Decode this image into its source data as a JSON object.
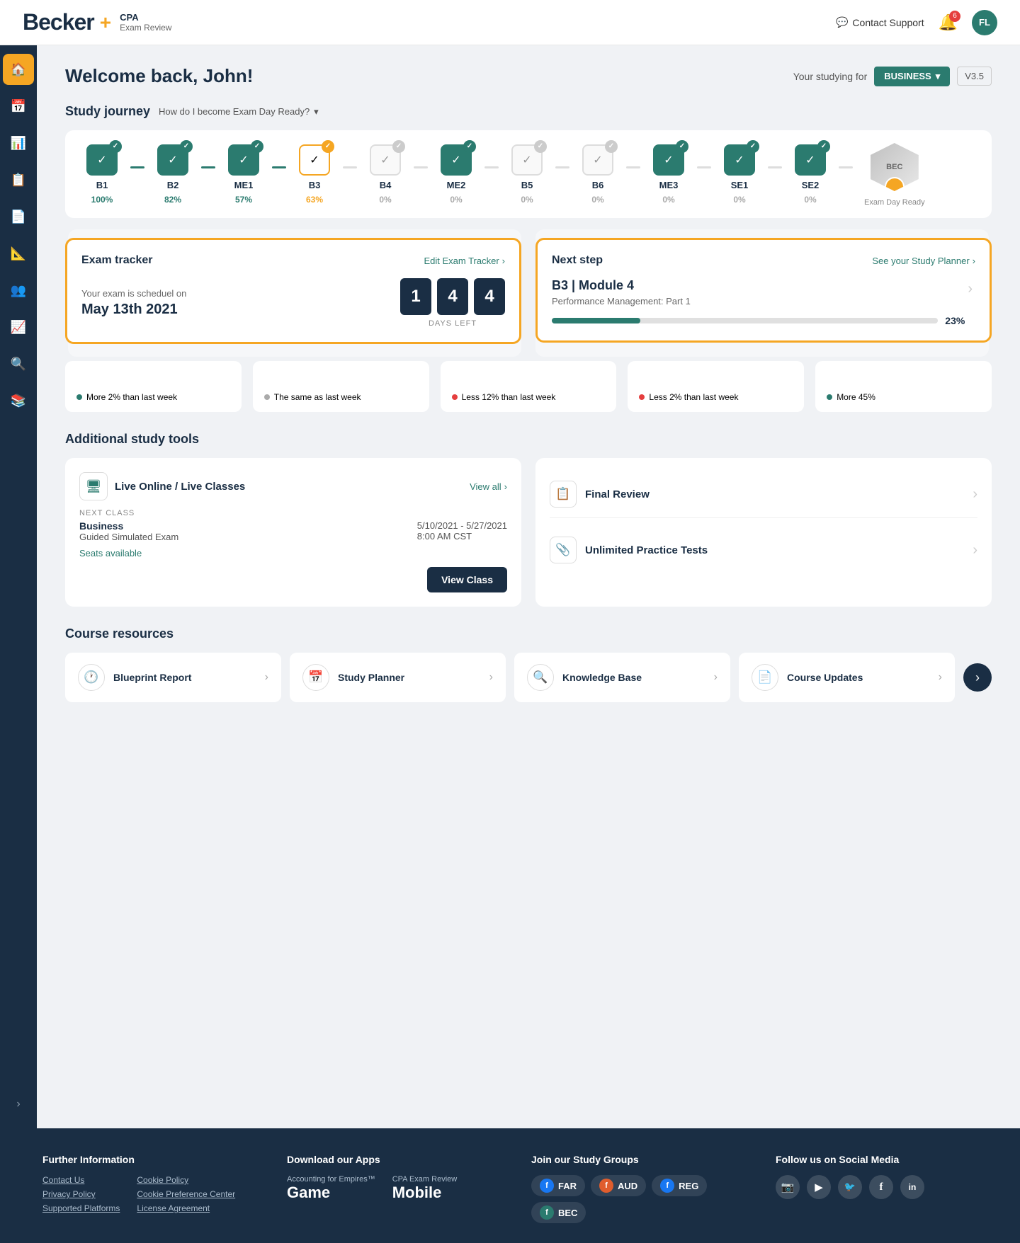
{
  "header": {
    "logo": "Becker",
    "logo_plus": "+",
    "subtitle1": "CPA",
    "subtitle2": "Exam Review",
    "contact_support": "Contact Support",
    "notif_count": "6",
    "avatar_initials": "FL"
  },
  "sidebar": {
    "items": [
      {
        "icon": "🏠",
        "label": "home",
        "active": true
      },
      {
        "icon": "📅",
        "label": "calendar",
        "active": false
      },
      {
        "icon": "📊",
        "label": "charts",
        "active": false
      },
      {
        "icon": "📋",
        "label": "clipboard",
        "active": false
      },
      {
        "icon": "📄",
        "label": "document",
        "active": false
      },
      {
        "icon": "📐",
        "label": "ruler",
        "active": false
      },
      {
        "icon": "👥",
        "label": "people",
        "active": false
      },
      {
        "icon": "📈",
        "label": "bar-chart",
        "active": false
      },
      {
        "icon": "🔍",
        "label": "search",
        "active": false
      },
      {
        "icon": "📚",
        "label": "book",
        "active": false
      }
    ],
    "expand": "›"
  },
  "welcome": {
    "title": "Welcome back, John!",
    "studying_for_label": "Your studying for",
    "subject": "BUSINESS",
    "version": "V3.5"
  },
  "study_journey": {
    "title": "Study journey",
    "dropdown_label": "How do I become Exam Day Ready?",
    "steps": [
      {
        "label": "B1",
        "pct": "100%",
        "pct_class": "green",
        "state": "completed",
        "badge": "green"
      },
      {
        "label": "B2",
        "pct": "82%",
        "pct_class": "green",
        "state": "completed",
        "badge": "green"
      },
      {
        "label": "ME1",
        "pct": "57%",
        "pct_class": "green",
        "state": "active",
        "badge": "green"
      },
      {
        "label": "B3",
        "pct": "63%",
        "pct_class": "yellow",
        "state": "partial",
        "badge": "yellow"
      },
      {
        "label": "B4",
        "pct": "0%",
        "pct_class": "gray",
        "state": "inactive",
        "badge": "gray"
      },
      {
        "label": "ME2",
        "pct": "0%",
        "pct_class": "gray",
        "state": "active",
        "badge": "green"
      },
      {
        "label": "B5",
        "pct": "0%",
        "pct_class": "gray",
        "state": "inactive",
        "badge": "gray"
      },
      {
        "label": "B6",
        "pct": "0%",
        "pct_class": "gray",
        "state": "inactive",
        "badge": "gray"
      },
      {
        "label": "ME3",
        "pct": "0%",
        "pct_class": "gray",
        "state": "active",
        "badge": "green"
      },
      {
        "label": "SE1",
        "pct": "0%",
        "pct_class": "gray",
        "state": "active",
        "badge": "green"
      },
      {
        "label": "SE2",
        "pct": "0%",
        "pct_class": "gray",
        "state": "active",
        "badge": "green"
      }
    ],
    "exam_day": {
      "label": "BEC",
      "sublabel": "Exam Day Ready"
    }
  },
  "exam_tracker": {
    "title": "Exam tracker",
    "link": "Edit Exam Tracker",
    "scheduled_text": "Your exam is scheduel on",
    "date": "May 13th 2021",
    "days_left": [
      "1",
      "4",
      "4"
    ],
    "days_label": "DAYS LEFT"
  },
  "next_step": {
    "title": "Next step",
    "link": "See your Study Planner",
    "module_title": "B3 | Module 4",
    "module_sub": "Performance Management: Part 1",
    "progress_pct": 23,
    "progress_label": "23%"
  },
  "scores": [
    {
      "indicator": "More 2% than last week",
      "dot": "green"
    },
    {
      "indicator": "The same as last week",
      "dot": "gray"
    },
    {
      "indicator": "Less 12% than last week",
      "dot": "red"
    },
    {
      "indicator": "Less 2% than last week",
      "dot": "red"
    },
    {
      "indicator": "More 45%",
      "dot": "green"
    }
  ],
  "additional_tools": {
    "title": "Additional study tools",
    "live_classes": {
      "title": "Live Online / Live Classes",
      "icon": "🖥",
      "view_all": "View all",
      "next_class_label": "NEXT CLASS",
      "class_name": "Business",
      "class_type": "Guided Simulated Exam",
      "class_dates": "5/10/2021 - 5/27/2021",
      "class_time": "8:00 AM CST",
      "seats_text": "Seats available",
      "view_class_btn": "View Class"
    },
    "final_review": {
      "title": "Final Review",
      "icon": "📋"
    },
    "unlimited_practice": {
      "title": "Unlimited Practice Tests",
      "icon": "📎"
    }
  },
  "course_resources": {
    "title": "Course resources",
    "items": [
      {
        "icon": "🕐",
        "label": "Blueprint Report"
      },
      {
        "icon": "📅",
        "label": "Study Planner"
      },
      {
        "icon": "🔍",
        "label": "Knowledge Base"
      },
      {
        "icon": "📄",
        "label": "Course Updates"
      }
    ]
  },
  "footer": {
    "further_info": {
      "title": "Further Information",
      "links": [
        "Contact Us",
        "Privacy Policy",
        "Supported Platforms",
        "Cookie Policy",
        "Cookie Preference Center",
        "License Agreement"
      ]
    },
    "apps": {
      "title": "Download our Apps",
      "app1_label": "Accounting for Empires™",
      "app1_name": "Game",
      "app2_label": "CPA Exam Review",
      "app2_name": "Mobile"
    },
    "study_groups": {
      "title": "Join our Study Groups",
      "groups": [
        {
          "icon": "f",
          "label": "FAR",
          "icon_bg": "sg-fb"
        },
        {
          "icon": "f",
          "label": "AUD",
          "icon_bg": "sg-fb2"
        },
        {
          "icon": "f",
          "label": "REG",
          "icon_bg": "sg-fb"
        },
        {
          "icon": "f",
          "label": "BEC",
          "icon_bg": "sg-fb"
        }
      ]
    },
    "social": {
      "title": "Follow us on Social Media",
      "icons": [
        "📷",
        "▶",
        "🐦",
        "f",
        "in"
      ]
    }
  }
}
